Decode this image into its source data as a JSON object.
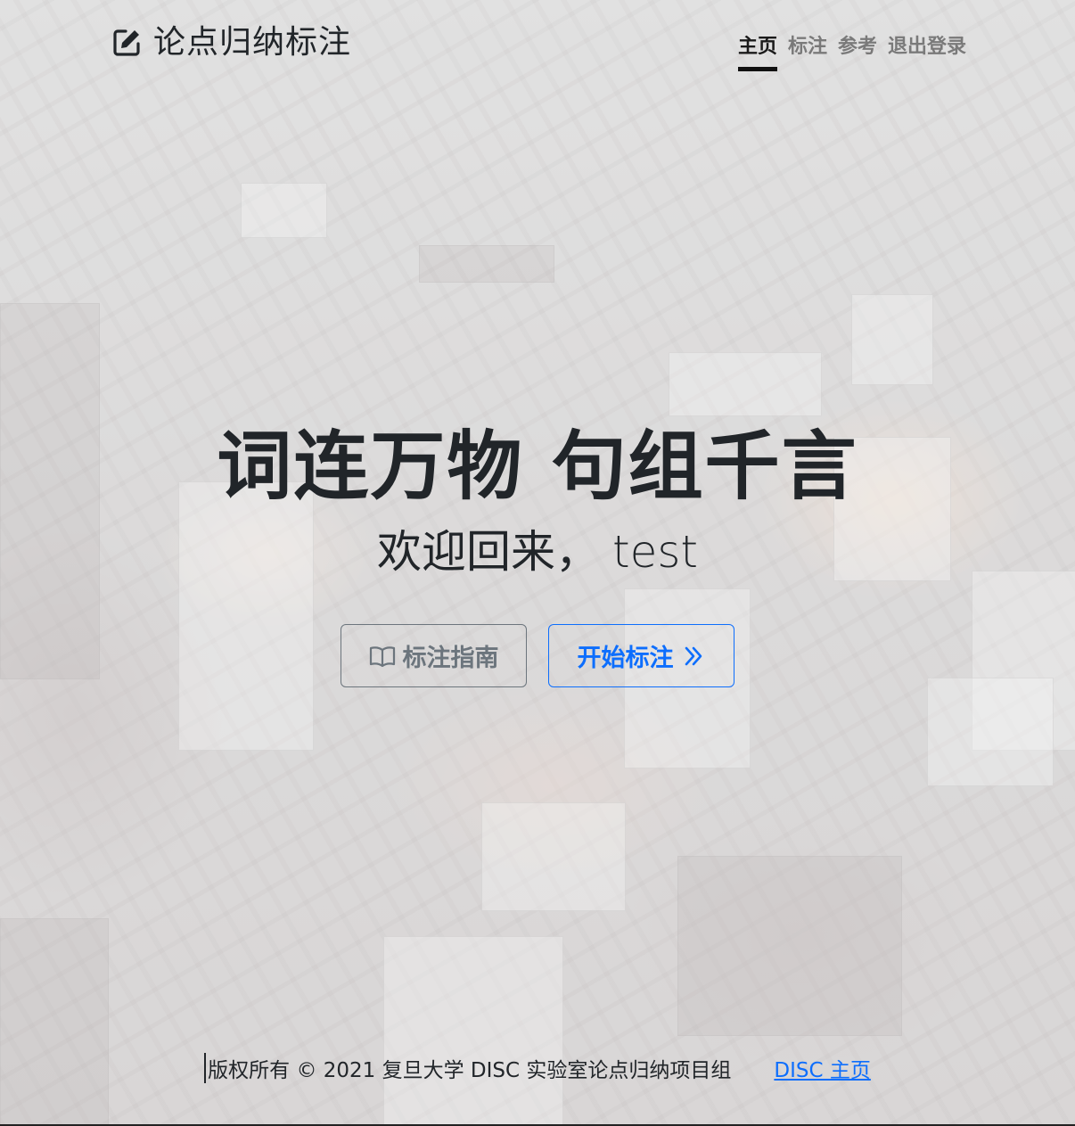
{
  "brand": {
    "title": "论点归纳标注",
    "icon": "edit-icon"
  },
  "nav": {
    "items": [
      {
        "label": "主页",
        "active": true
      },
      {
        "label": "标注",
        "active": false
      },
      {
        "label": "参考",
        "active": false
      },
      {
        "label": "退出登录",
        "active": false
      }
    ]
  },
  "hero": {
    "headline": "词连万物 句组千言",
    "welcome_prefix": "欢迎回来，",
    "username": "test"
  },
  "actions": {
    "guide_label": "标注指南",
    "guide_icon": "book-icon",
    "start_label": "开始标注",
    "start_icon": "chevron-double-right-icon"
  },
  "footer": {
    "copyright": "版权所有 © 2021 复旦大学 DISC 实验室论点归纳项目组",
    "link_label": "DISC 主页"
  },
  "colors": {
    "primary": "#0d6efd",
    "secondary": "#6c757d",
    "text": "#212529"
  }
}
